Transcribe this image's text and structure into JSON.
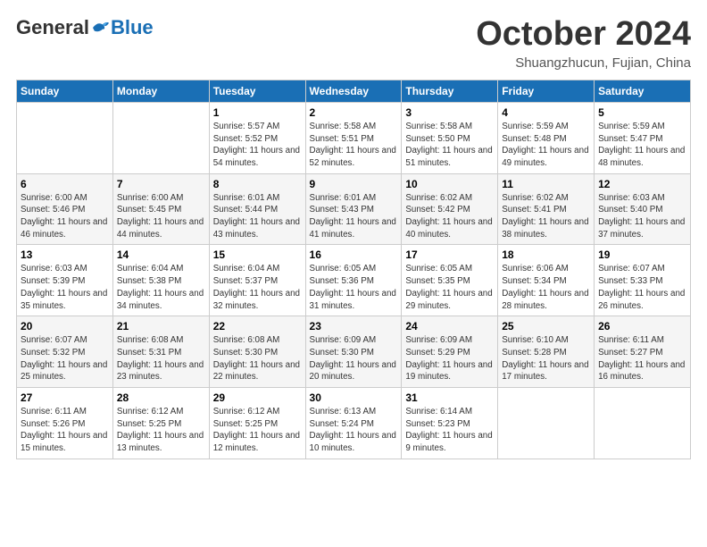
{
  "header": {
    "logo": {
      "general": "General",
      "blue": "Blue"
    },
    "title": "October 2024",
    "location": "Shuangzhucun, Fujian, China"
  },
  "weekdays": [
    "Sunday",
    "Monday",
    "Tuesday",
    "Wednesday",
    "Thursday",
    "Friday",
    "Saturday"
  ],
  "weeks": [
    [
      {
        "day": "",
        "sunrise": "",
        "sunset": "",
        "daylight": ""
      },
      {
        "day": "",
        "sunrise": "",
        "sunset": "",
        "daylight": ""
      },
      {
        "day": "1",
        "sunrise": "Sunrise: 5:57 AM",
        "sunset": "Sunset: 5:52 PM",
        "daylight": "Daylight: 11 hours and 54 minutes."
      },
      {
        "day": "2",
        "sunrise": "Sunrise: 5:58 AM",
        "sunset": "Sunset: 5:51 PM",
        "daylight": "Daylight: 11 hours and 52 minutes."
      },
      {
        "day": "3",
        "sunrise": "Sunrise: 5:58 AM",
        "sunset": "Sunset: 5:50 PM",
        "daylight": "Daylight: 11 hours and 51 minutes."
      },
      {
        "day": "4",
        "sunrise": "Sunrise: 5:59 AM",
        "sunset": "Sunset: 5:48 PM",
        "daylight": "Daylight: 11 hours and 49 minutes."
      },
      {
        "day": "5",
        "sunrise": "Sunrise: 5:59 AM",
        "sunset": "Sunset: 5:47 PM",
        "daylight": "Daylight: 11 hours and 48 minutes."
      }
    ],
    [
      {
        "day": "6",
        "sunrise": "Sunrise: 6:00 AM",
        "sunset": "Sunset: 5:46 PM",
        "daylight": "Daylight: 11 hours and 46 minutes."
      },
      {
        "day": "7",
        "sunrise": "Sunrise: 6:00 AM",
        "sunset": "Sunset: 5:45 PM",
        "daylight": "Daylight: 11 hours and 44 minutes."
      },
      {
        "day": "8",
        "sunrise": "Sunrise: 6:01 AM",
        "sunset": "Sunset: 5:44 PM",
        "daylight": "Daylight: 11 hours and 43 minutes."
      },
      {
        "day": "9",
        "sunrise": "Sunrise: 6:01 AM",
        "sunset": "Sunset: 5:43 PM",
        "daylight": "Daylight: 11 hours and 41 minutes."
      },
      {
        "day": "10",
        "sunrise": "Sunrise: 6:02 AM",
        "sunset": "Sunset: 5:42 PM",
        "daylight": "Daylight: 11 hours and 40 minutes."
      },
      {
        "day": "11",
        "sunrise": "Sunrise: 6:02 AM",
        "sunset": "Sunset: 5:41 PM",
        "daylight": "Daylight: 11 hours and 38 minutes."
      },
      {
        "day": "12",
        "sunrise": "Sunrise: 6:03 AM",
        "sunset": "Sunset: 5:40 PM",
        "daylight": "Daylight: 11 hours and 37 minutes."
      }
    ],
    [
      {
        "day": "13",
        "sunrise": "Sunrise: 6:03 AM",
        "sunset": "Sunset: 5:39 PM",
        "daylight": "Daylight: 11 hours and 35 minutes."
      },
      {
        "day": "14",
        "sunrise": "Sunrise: 6:04 AM",
        "sunset": "Sunset: 5:38 PM",
        "daylight": "Daylight: 11 hours and 34 minutes."
      },
      {
        "day": "15",
        "sunrise": "Sunrise: 6:04 AM",
        "sunset": "Sunset: 5:37 PM",
        "daylight": "Daylight: 11 hours and 32 minutes."
      },
      {
        "day": "16",
        "sunrise": "Sunrise: 6:05 AM",
        "sunset": "Sunset: 5:36 PM",
        "daylight": "Daylight: 11 hours and 31 minutes."
      },
      {
        "day": "17",
        "sunrise": "Sunrise: 6:05 AM",
        "sunset": "Sunset: 5:35 PM",
        "daylight": "Daylight: 11 hours and 29 minutes."
      },
      {
        "day": "18",
        "sunrise": "Sunrise: 6:06 AM",
        "sunset": "Sunset: 5:34 PM",
        "daylight": "Daylight: 11 hours and 28 minutes."
      },
      {
        "day": "19",
        "sunrise": "Sunrise: 6:07 AM",
        "sunset": "Sunset: 5:33 PM",
        "daylight": "Daylight: 11 hours and 26 minutes."
      }
    ],
    [
      {
        "day": "20",
        "sunrise": "Sunrise: 6:07 AM",
        "sunset": "Sunset: 5:32 PM",
        "daylight": "Daylight: 11 hours and 25 minutes."
      },
      {
        "day": "21",
        "sunrise": "Sunrise: 6:08 AM",
        "sunset": "Sunset: 5:31 PM",
        "daylight": "Daylight: 11 hours and 23 minutes."
      },
      {
        "day": "22",
        "sunrise": "Sunrise: 6:08 AM",
        "sunset": "Sunset: 5:30 PM",
        "daylight": "Daylight: 11 hours and 22 minutes."
      },
      {
        "day": "23",
        "sunrise": "Sunrise: 6:09 AM",
        "sunset": "Sunset: 5:30 PM",
        "daylight": "Daylight: 11 hours and 20 minutes."
      },
      {
        "day": "24",
        "sunrise": "Sunrise: 6:09 AM",
        "sunset": "Sunset: 5:29 PM",
        "daylight": "Daylight: 11 hours and 19 minutes."
      },
      {
        "day": "25",
        "sunrise": "Sunrise: 6:10 AM",
        "sunset": "Sunset: 5:28 PM",
        "daylight": "Daylight: 11 hours and 17 minutes."
      },
      {
        "day": "26",
        "sunrise": "Sunrise: 6:11 AM",
        "sunset": "Sunset: 5:27 PM",
        "daylight": "Daylight: 11 hours and 16 minutes."
      }
    ],
    [
      {
        "day": "27",
        "sunrise": "Sunrise: 6:11 AM",
        "sunset": "Sunset: 5:26 PM",
        "daylight": "Daylight: 11 hours and 15 minutes."
      },
      {
        "day": "28",
        "sunrise": "Sunrise: 6:12 AM",
        "sunset": "Sunset: 5:25 PM",
        "daylight": "Daylight: 11 hours and 13 minutes."
      },
      {
        "day": "29",
        "sunrise": "Sunrise: 6:12 AM",
        "sunset": "Sunset: 5:25 PM",
        "daylight": "Daylight: 11 hours and 12 minutes."
      },
      {
        "day": "30",
        "sunrise": "Sunrise: 6:13 AM",
        "sunset": "Sunset: 5:24 PM",
        "daylight": "Daylight: 11 hours and 10 minutes."
      },
      {
        "day": "31",
        "sunrise": "Sunrise: 6:14 AM",
        "sunset": "Sunset: 5:23 PM",
        "daylight": "Daylight: 11 hours and 9 minutes."
      },
      {
        "day": "",
        "sunrise": "",
        "sunset": "",
        "daylight": ""
      },
      {
        "day": "",
        "sunrise": "",
        "sunset": "",
        "daylight": ""
      }
    ]
  ]
}
